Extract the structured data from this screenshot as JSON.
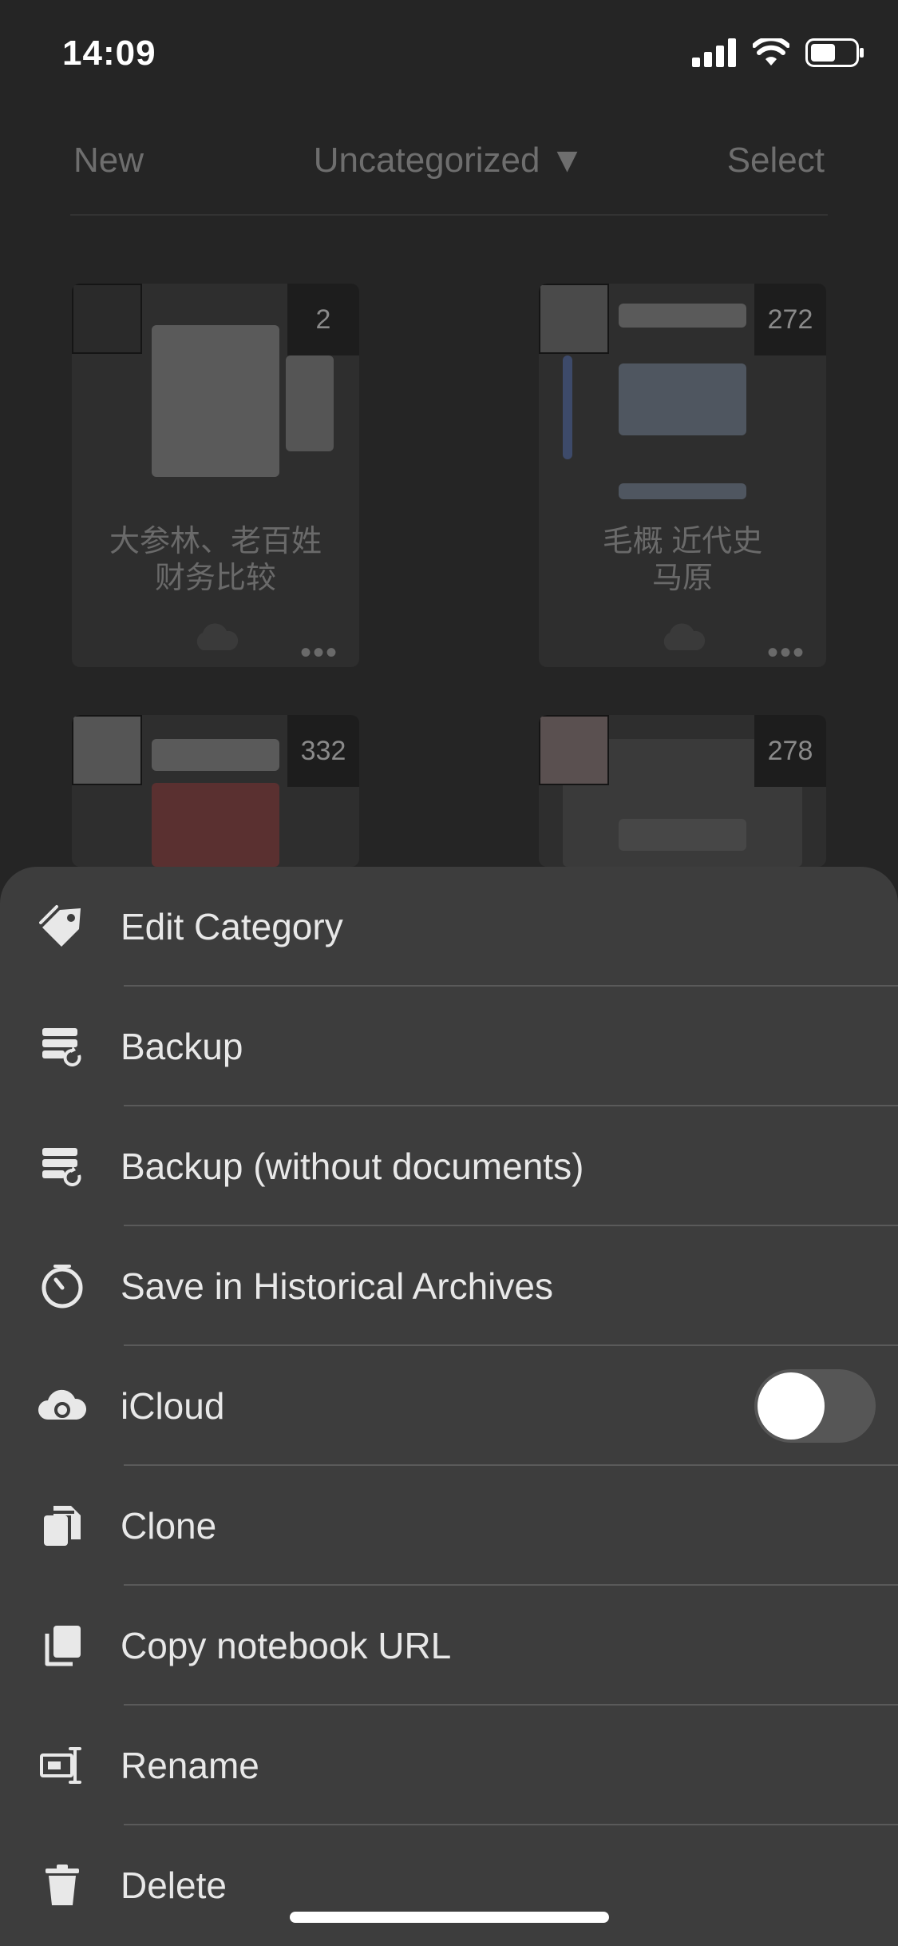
{
  "status_bar": {
    "time": "14:09"
  },
  "nav": {
    "left": "New",
    "center": "Uncategorized ▼",
    "right": "Select"
  },
  "notebooks": [
    {
      "title_line1": "大参林、老百姓",
      "title_line2": "财务比较",
      "count": "2"
    },
    {
      "title_line1": "毛概 近代史",
      "title_line2": "马原",
      "count": "272"
    },
    {
      "count": "332"
    },
    {
      "count": "278"
    }
  ],
  "menu": [
    {
      "label": "Edit Category",
      "icon": "tag-icon"
    },
    {
      "label": "Backup",
      "icon": "backup-icon"
    },
    {
      "label": "Backup (without documents)",
      "icon": "backup-icon"
    },
    {
      "label": "Save in Historical Archives",
      "icon": "clock-icon"
    },
    {
      "label": "iCloud",
      "icon": "cloud-sync-icon",
      "toggle": false
    },
    {
      "label": "Clone",
      "icon": "clone-icon"
    },
    {
      "label": "Copy notebook URL",
      "icon": "copy-icon"
    },
    {
      "label": "Rename",
      "icon": "rename-icon"
    },
    {
      "label": "Delete",
      "icon": "trash-icon"
    }
  ]
}
